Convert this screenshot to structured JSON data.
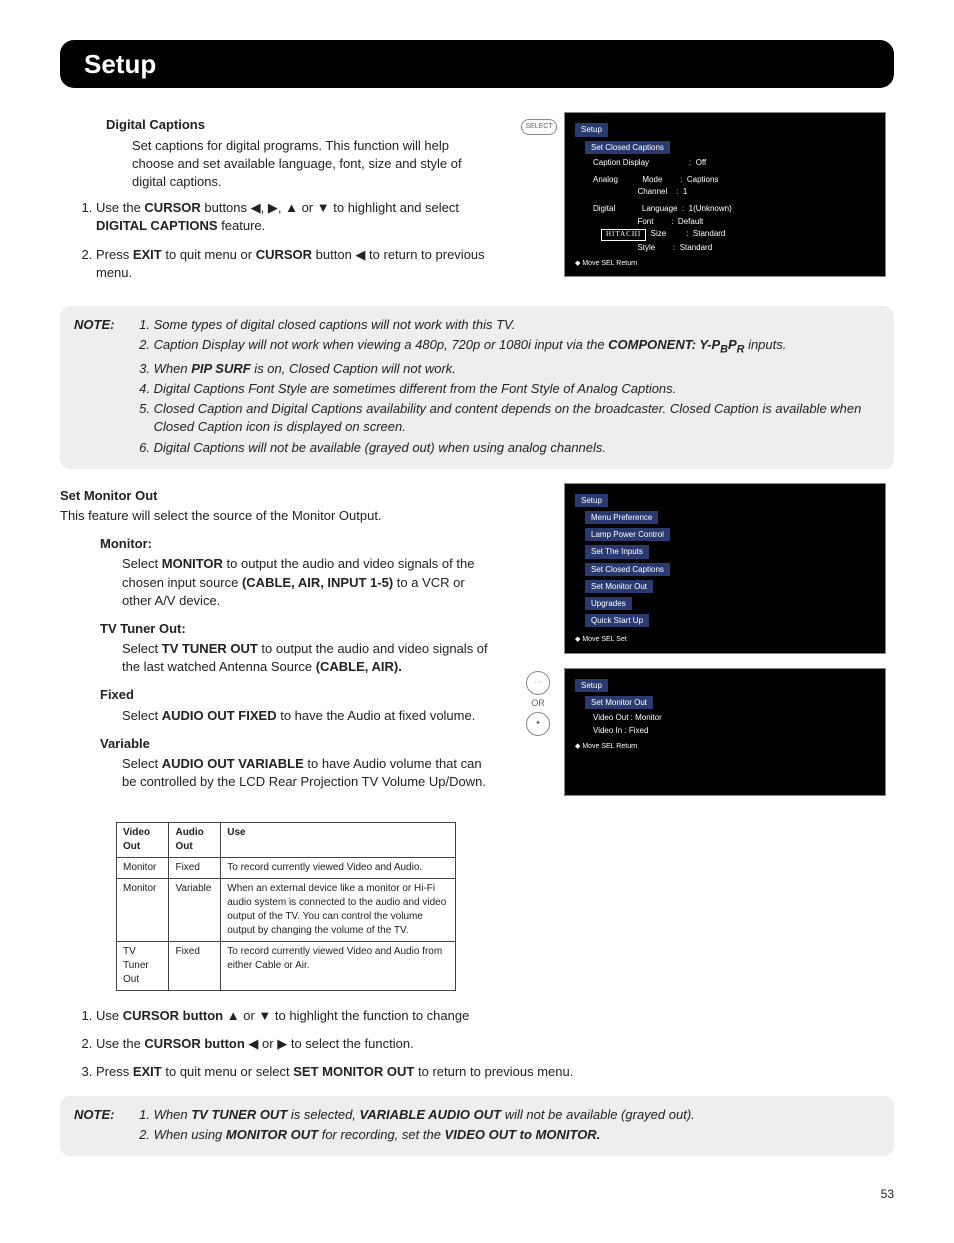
{
  "pageTitle": "Setup",
  "pageNumber": "53",
  "digitalCaptions": {
    "heading": "Digital Captions",
    "intro": "Set captions for digital programs. This function will help choose and set available language, font, size and style of digital captions.",
    "steps": [
      "Use the CURSOR buttons ◀, ▶, ▲ or ▼ to highlight and select DIGITAL CAPTIONS feature.",
      "Press EXIT to quit menu or CURSOR button ◀ to return to previous menu."
    ]
  },
  "captionNotes": {
    "label": "NOTE:",
    "items": [
      "Some types of digital closed captions will not work with this TV.",
      "Caption Display will not work when viewing a 480p, 720p or 1080i input via the COMPONENT: Y-PBPR inputs.",
      "When PIP SURF is on, Closed Caption will not work.",
      "Digital Captions Font Style are sometimes different from the Font Style of Analog Captions.",
      "Closed Caption and Digital Captions availability and content depends on the broadcaster. Closed Caption is available when Closed Caption icon is displayed on screen.",
      "Digital Captions will not be available (grayed out) when using analog channels."
    ]
  },
  "setMonitorOut": {
    "heading": "Set Monitor Out",
    "intro": "This feature will select the source of the Monitor Output.",
    "defs": [
      {
        "term": "Monitor:",
        "body": "Select MONITOR to output the audio and video signals of the chosen input source (CABLE, AIR, INPUT 1-5) to a VCR or other A/V device."
      },
      {
        "term": "TV Tuner Out:",
        "body": "Select TV TUNER OUT to output the audio and video signals of the last watched Antenna Source (CABLE, AIR)."
      },
      {
        "term": "Fixed",
        "body": "Select AUDIO OUT FIXED to have the Audio at fixed volume."
      },
      {
        "term": "Variable",
        "body": "Select AUDIO OUT VARIABLE to have Audio volume that can be controlled by the LCD Rear Projection TV Volume Up/Down."
      }
    ]
  },
  "outTable": {
    "headers": [
      "Video Out",
      "Audio Out",
      "Use"
    ],
    "rows": [
      [
        "Monitor",
        "Fixed",
        "To record currently viewed Video and Audio."
      ],
      [
        "Monitor",
        "Variable",
        "When an external device like a monitor or Hi-Fi audio system is connected to the audio and video output of the TV. You can control the volume output by changing the volume of the TV."
      ],
      [
        "TV Tuner Out",
        "Fixed",
        "To record currently viewed Video and Audio from either Cable or Air."
      ]
    ]
  },
  "bottomSteps": [
    "Use CURSOR button ▲ or ▼ to highlight the function to change",
    "Use the CURSOR button ◀ or ▶ to select the function.",
    "Press EXIT to quit menu or select SET MONITOR OUT to return to previous menu."
  ],
  "bottomNotes": {
    "label": "NOTE:",
    "items": [
      "When TV TUNER OUT is selected, VARIABLE AUDIO OUT will not be available (grayed out).",
      "When using MONITOR OUT for recording, set the VIDEO OUT to MONITOR."
    ]
  },
  "osd1": {
    "menu1": "Setup",
    "menu2": "Set Closed Captions",
    "r1l": "Caption Display",
    "r1v": "Off",
    "r2l": "Analog",
    "r2m": "Mode",
    "r2v": "Captions",
    "r3m": "Channel",
    "r3v": "1",
    "r4l": "Digital",
    "r4m": "Language",
    "r4v": "1(Unknown)",
    "r5m": "Font",
    "r5v": "Default",
    "r6m": "Size",
    "r6v": "Standard",
    "r7m": "Style",
    "r7v": "Standard",
    "brand": "HITACHI",
    "foot": "◆ Move   SEL Return",
    "selectBtn": "SELECT"
  },
  "osd2": {
    "menu1": "Setup",
    "items": [
      "Menu Preference",
      "Lamp Power Control",
      "Set The Inputs",
      "Set Closed Captions",
      "Set Monitor Out",
      "Upgrades",
      "Quick Start Up"
    ],
    "foot": "◆ Move   SEL Set"
  },
  "osd3": {
    "menu1": "Setup",
    "menu2": "Set Monitor Out",
    "r1": "Video Out   :   Monitor",
    "r2": "Video In    :   Fixed",
    "foot": "◆ Move   SEL Return",
    "orLabel": "OR"
  }
}
